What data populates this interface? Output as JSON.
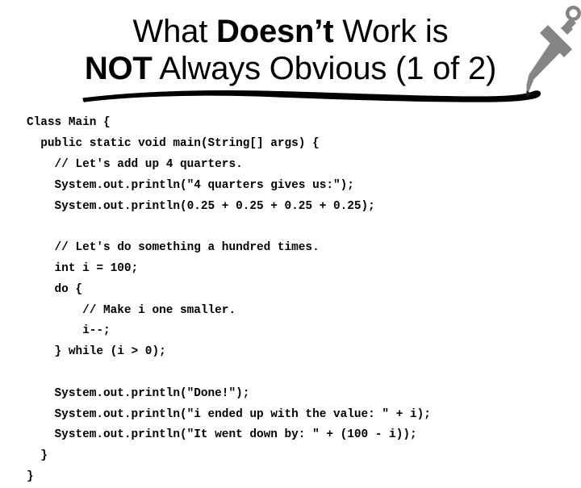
{
  "slide": {
    "background_color": "#ffffff",
    "text_color": "#000000",
    "accent_color": "#858585"
  },
  "title": {
    "line1_plain_before": "What ",
    "line1_bold": "Doesn’t",
    "line1_plain_after": " Work is",
    "line2_bold": "NOT",
    "line2_plain": " Always Obvious (1 of 2)",
    "full_text": "What Doesn’t Work is NOT Always Obvious (1 of 2)"
  },
  "decoration": {
    "sword_icon_name": "sword-icon",
    "sword_color": "#858585",
    "underline_name": "hand-drawn-underline",
    "underline_color": "#000000"
  },
  "code": {
    "language": "java",
    "lines": [
      "Class Main {",
      "  public static void main(String[] args) {",
      "    // Let's add up 4 quarters.",
      "    System.out.println(\"4 quarters gives us:\");",
      "    System.out.println(0.25 + 0.25 + 0.25 + 0.25);",
      "",
      "    // Let's do something a hundred times.",
      "    int i = 100;",
      "    do {",
      "        // Make i one smaller.",
      "        i--;",
      "    } while (i > 0);",
      "",
      "    System.out.println(\"Done!\");",
      "    System.out.println(\"i ended up with the value: \" + i);",
      "    System.out.println(\"It went down by: \" + (100 - i));",
      "  }",
      "}"
    ]
  }
}
